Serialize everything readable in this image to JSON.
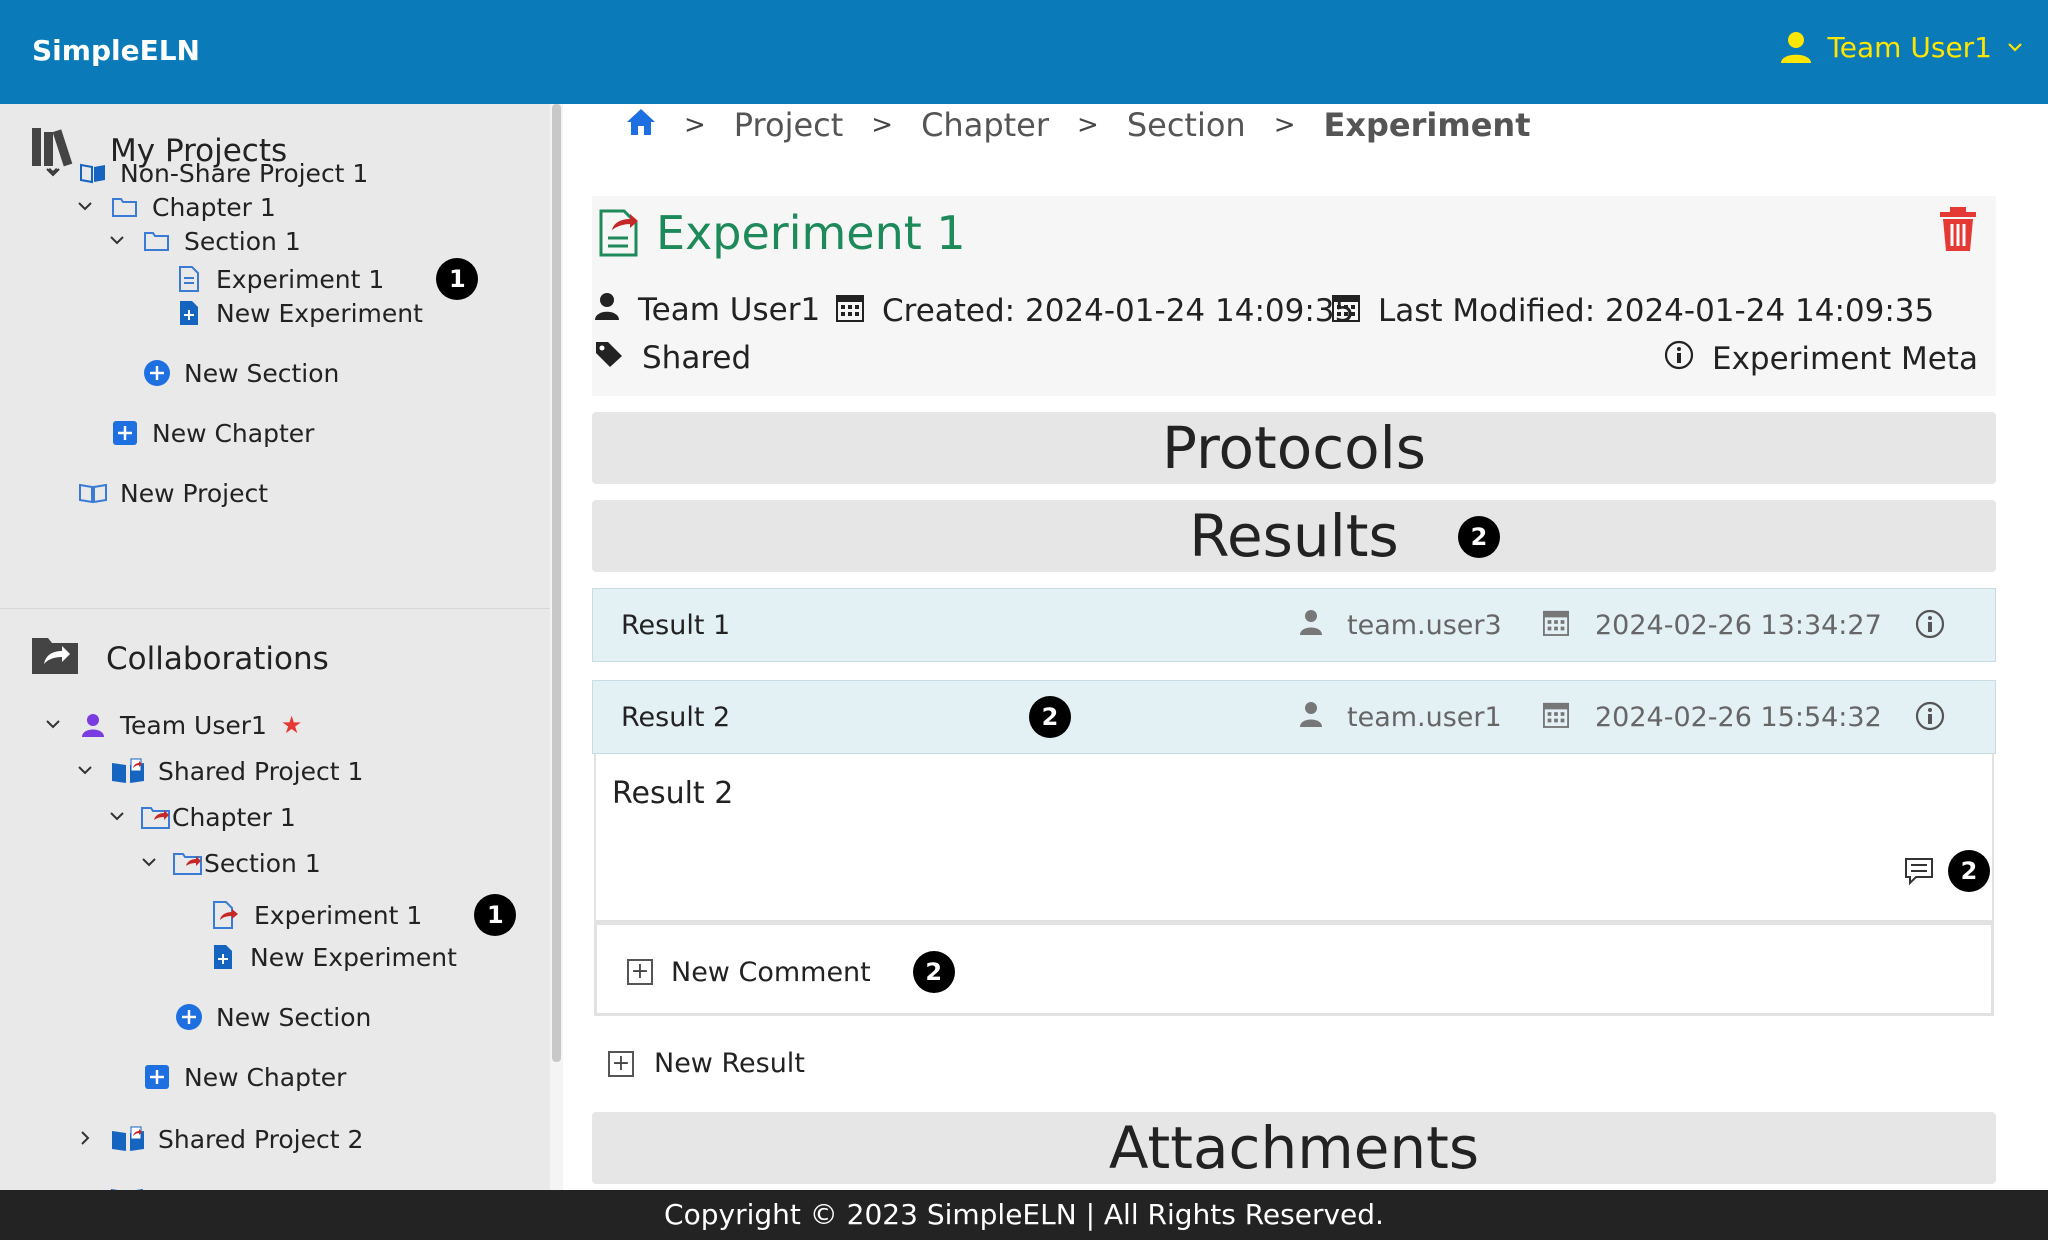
{
  "header": {
    "brand": "SimpleELN",
    "user": "Team User1",
    "brand_color": "#0a7ab8",
    "user_color": "#ffe600"
  },
  "sidebar": {
    "my_projects_title": "My Projects",
    "my_projects": [
      {
        "label": "Non-Share Project 1",
        "icon": "book-open-icon",
        "chevron": "down"
      },
      {
        "label": "Chapter 1",
        "icon": "folder-open-icon",
        "chevron": "down"
      },
      {
        "label": "Section 1",
        "icon": "folder-open-icon",
        "chevron": "down"
      },
      {
        "label": "Experiment 1",
        "icon": "document-icon",
        "badge": "1"
      },
      {
        "label": "New Experiment",
        "icon": "new-document-icon"
      },
      {
        "label": "New Section",
        "icon": "plus-circle-icon"
      },
      {
        "label": "New Chapter",
        "icon": "plus-square-icon"
      },
      {
        "label": "New Project",
        "icon": "book-icon"
      }
    ],
    "collab_title": "Collaborations",
    "collaborations": [
      {
        "label": "Team User1",
        "icon": "user-icon",
        "star": "★"
      },
      {
        "label": "Shared Project 1",
        "icon": "shared-book-icon",
        "chevron": "down"
      },
      {
        "label": "Chapter 1",
        "icon": "shared-folder-icon",
        "chevron": "down"
      },
      {
        "label": "Section 1",
        "icon": "shared-folder-icon",
        "chevron": "down"
      },
      {
        "label": "Experiment 1",
        "icon": "shared-document-icon",
        "badge": "1"
      },
      {
        "label": "New Experiment",
        "icon": "new-document-icon"
      },
      {
        "label": "New Section",
        "icon": "plus-circle-icon"
      },
      {
        "label": "New Chapter",
        "icon": "plus-square-icon"
      },
      {
        "label": "Shared Project 2",
        "icon": "shared-book-icon",
        "chevron": "right"
      }
    ]
  },
  "breadcrumb": {
    "items": [
      "Project",
      "Chapter",
      "Section"
    ],
    "current": "Experiment",
    "separator": ">"
  },
  "experiment": {
    "title": "Experiment 1",
    "owner": "Team User1",
    "created": "Created: 2024-01-24 14:09:35",
    "modified": "Last Modified: 2024-01-24 14:09:35",
    "tag": "Shared",
    "meta_link": "Experiment Meta"
  },
  "sections": {
    "protocols": "Protocols",
    "results": "Results",
    "attachments": "Attachments",
    "results_badge": "2"
  },
  "results": [
    {
      "name": "Result 1",
      "user": "team.user3",
      "date": "2024-02-26 13:34:27"
    },
    {
      "name": "Result 2",
      "user": "team.user1",
      "date": "2024-02-26 15:54:32",
      "badge": "2"
    }
  ],
  "result_detail": {
    "content": "Result 2",
    "comment_badge": "2",
    "new_comment": "New Comment",
    "new_comment_badge": "2"
  },
  "new_result": "New Result",
  "footer": "Copyright © 2023 SimpleELN | All Rights Reserved."
}
